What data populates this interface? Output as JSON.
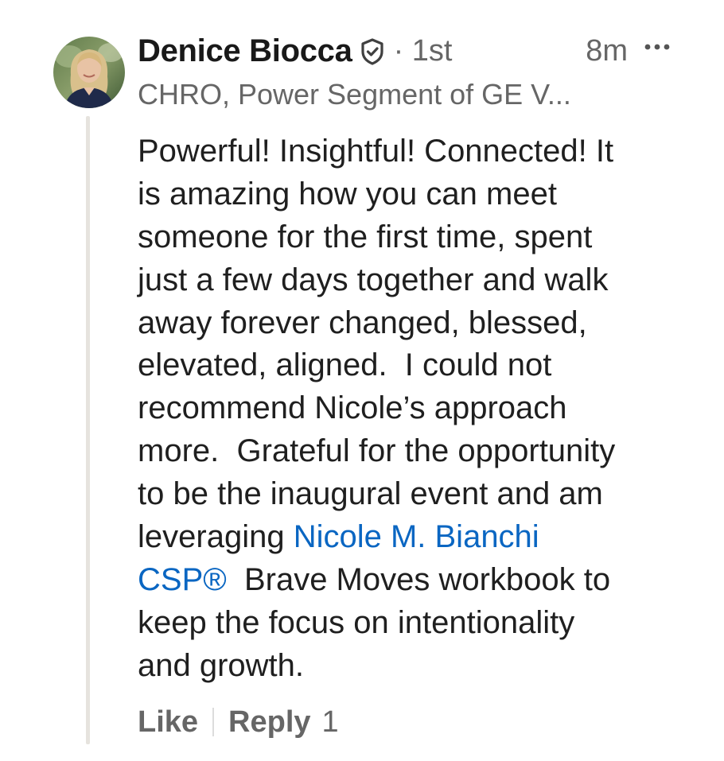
{
  "comment": {
    "author": {
      "name": "Denice Biocca",
      "verified_icon": "verified-shield-check-icon",
      "connection_degree": "· 1st",
      "headline": "CHRO, Power Segment of GE V..."
    },
    "timestamp": "8m",
    "more_icon": "more-horizontal-icon",
    "body_lines": [
      "Powerful! Insightful! Connected! It",
      "is amazing how you can meet",
      "someone for the first time, spent",
      "just a few days together and walk",
      "away forever changed, blessed,",
      "elevated, aligned.  I could not",
      "recommend Nicole’s approach",
      "more.  Grateful for the opportunity",
      "to be the inaugural event and am"
    ],
    "line_10_prefix": "leveraging ",
    "mention_part1": "Nicole M. Bianchi",
    "mention_part2": "CSP®",
    "line_11_suffix": "  Brave Moves workbook to",
    "body_lines_end": [
      "keep the focus on intentionality",
      "and growth."
    ]
  },
  "actions": {
    "like_label": "Like",
    "reply_label": "Reply",
    "reply_count": "1"
  },
  "colors": {
    "mention": "#0a66c2",
    "secondary_text": "#666666",
    "primary_text": "#1f1f1f",
    "thread_line": "#e6e3de"
  }
}
